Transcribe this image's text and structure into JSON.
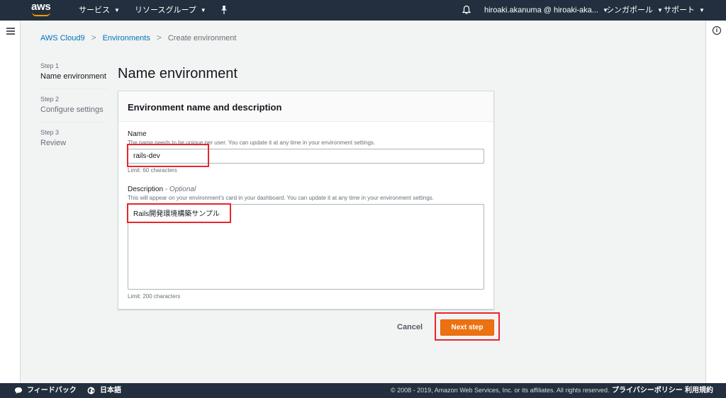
{
  "topnav": {
    "logo_text": "aws",
    "services_label": "サービス",
    "resource_groups_label": "リソースグループ",
    "pin_icon": "pin-icon",
    "bell_icon": "bell-icon",
    "account_label": "hiroaki.akanuma @ hiroaki-aka...",
    "region_label": "シンガポール",
    "support_label": "サポート"
  },
  "breadcrumb": {
    "items": [
      "AWS Cloud9",
      "Environments",
      "Create environment"
    ]
  },
  "steps": [
    {
      "num": "Step 1",
      "label": "Name environment"
    },
    {
      "num": "Step 2",
      "label": "Configure settings"
    },
    {
      "num": "Step 3",
      "label": "Review"
    }
  ],
  "page_title": "Name environment",
  "panel": {
    "header": "Environment name and description",
    "name": {
      "label": "Name",
      "description": "The name needs to be unique per user. You can update it at any time in your environment settings.",
      "value": "rails-dev",
      "limit": "Limit: 60 characters"
    },
    "description": {
      "label": "Description",
      "optional": " - Optional",
      "description": "This will appear on your environment's card in your dashboard. You can update it at any time in your environment settings.",
      "value": "Rails開発環境構築サンプル",
      "limit": "Limit: 200 characters"
    }
  },
  "actions": {
    "cancel_label": "Cancel",
    "next_label": "Next step"
  },
  "footer": {
    "feedback_label": "フィードバック",
    "language_label": "日本語",
    "copyright": "© 2008 - 2019, Amazon Web Services, Inc. or its affiliates. All rights reserved.",
    "privacy_label": "プライバシーポリシー",
    "terms_label": "利用規約"
  },
  "colors": {
    "nav_bg": "#232f3e",
    "primary_button": "#ec7211",
    "link": "#0073bb",
    "highlight": "#e8262a"
  }
}
